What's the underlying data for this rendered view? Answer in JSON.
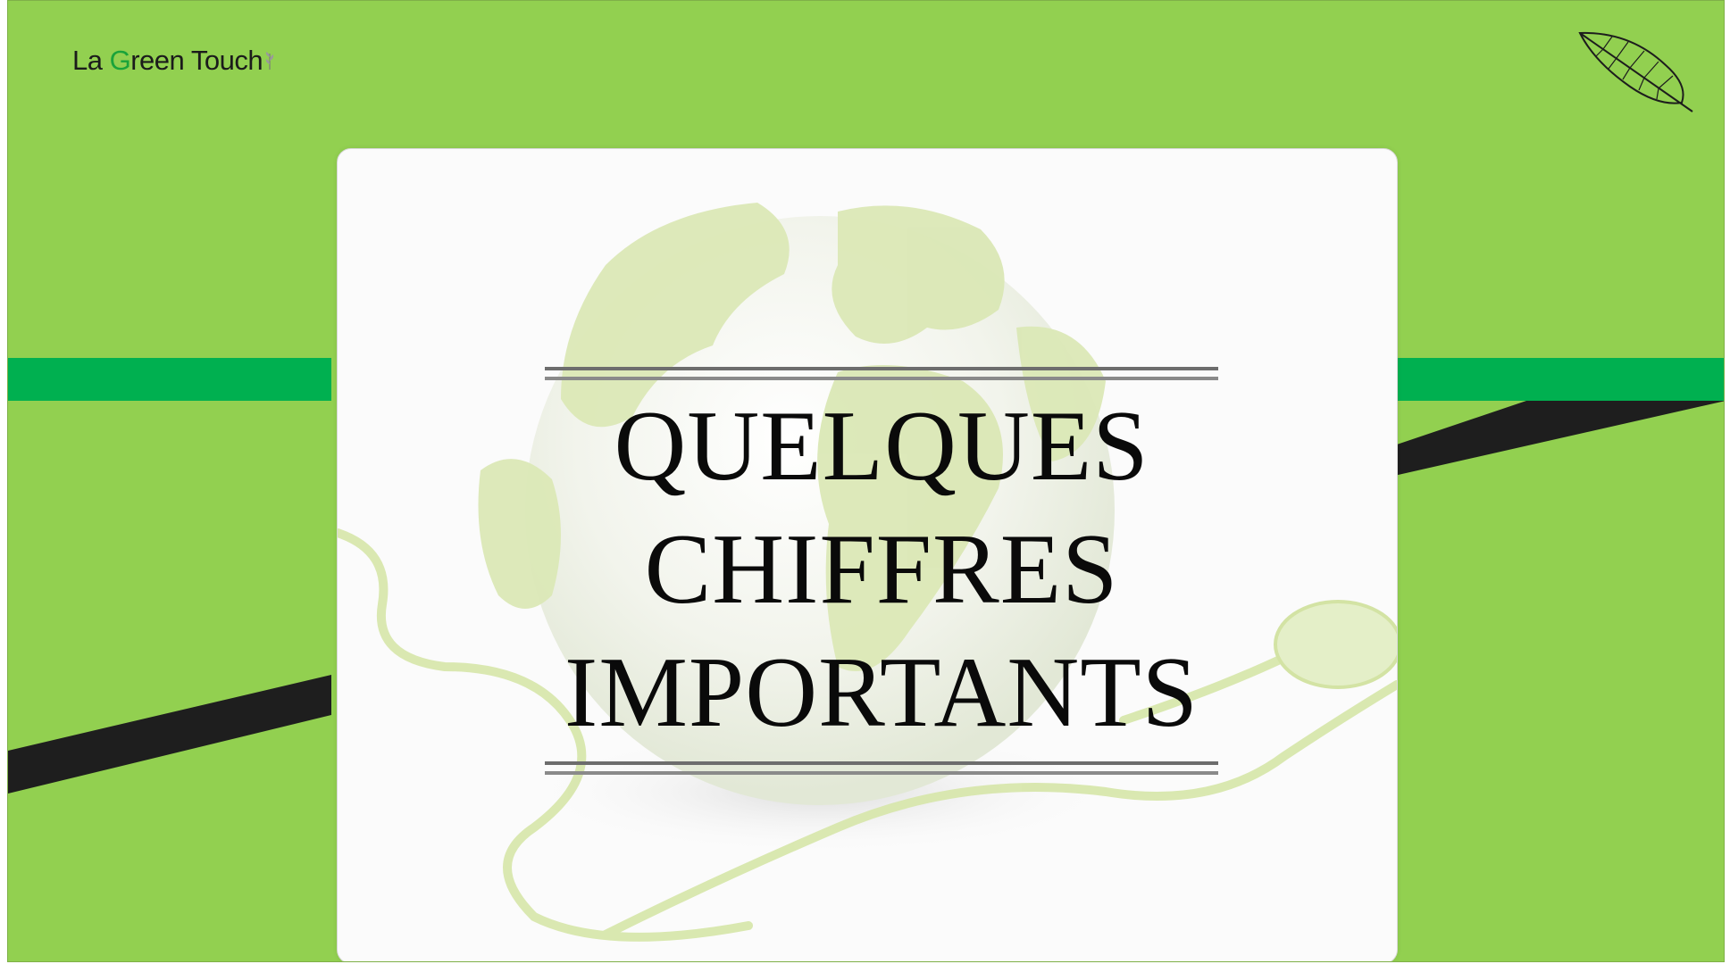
{
  "brand": {
    "name_prefix": "La ",
    "name_g": "G",
    "name_rest": "reen Touch",
    "logo_icon": "sprout-icon"
  },
  "decoration": {
    "corner_icon": "leaf-icon",
    "background_image": "globe-with-mouse-cable",
    "colors": {
      "background": "#92d050",
      "band_green": "#00b050",
      "band_black": "#1e1e1e",
      "logo_g": "#1aa33a"
    }
  },
  "title": {
    "lines": [
      "QUELQUES",
      "CHIFFRES",
      "IMPORTANTS"
    ]
  }
}
